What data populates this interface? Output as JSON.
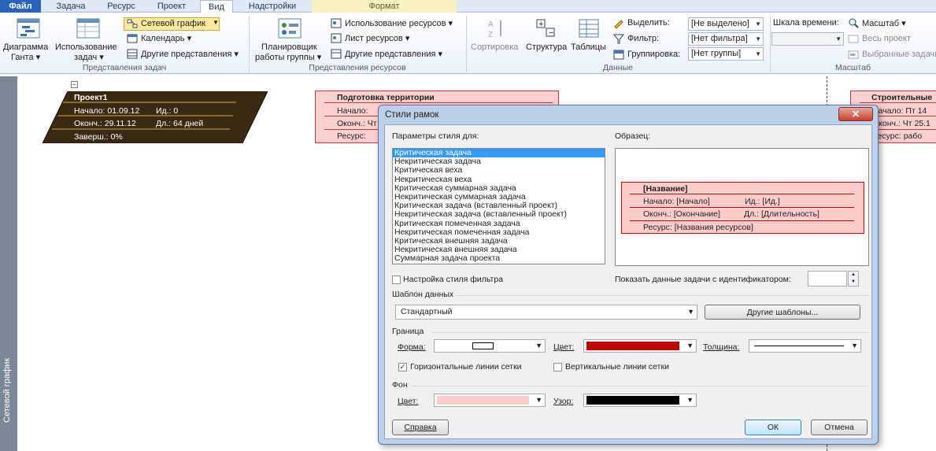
{
  "ribbon": {
    "tabs": [
      {
        "label": "Файл"
      },
      {
        "label": "Задача"
      },
      {
        "label": "Ресурс"
      },
      {
        "label": "Проект"
      },
      {
        "label": "Вид"
      },
      {
        "label": "Надстройки"
      },
      {
        "label": "Формат"
      }
    ],
    "task_views": {
      "gantt": "Диаграмма",
      "gantt2": "Ганта ▾",
      "usage": "Использование",
      "usage2": "задач ▾",
      "network": "Сетевой график",
      "calendar": "Календарь ▾",
      "other": "Другие представления ▾",
      "group_label": "Представления задач"
    },
    "resource_views": {
      "planner": "Планировщик",
      "planner2": "работы группы ▾",
      "usage": "Использование ресурсов ▾",
      "sheet": "Лист ресурсов ▾",
      "other": "Другие представления ▾",
      "group_label": "Представления ресурсов"
    },
    "data": {
      "sort": "Сортировка",
      "outline": "Структура",
      "tables": "Таблицы",
      "highlight_label": "Выделить:",
      "highlight_value": "[Не выделено]",
      "filter_label": "Фильтр:",
      "filter_value": "[Нет фильтра]",
      "group_label": "Группировка:",
      "group_value": "[Нет группы]",
      "section": "Данные"
    },
    "zoom": {
      "timescale": "Шкала времени:",
      "zoom": "Масштаб ▾",
      "entire": "Весь проект",
      "selected": "Выбранные задачи",
      "section": "Масштаб"
    }
  },
  "sidebar": {
    "label": "Сетевой график"
  },
  "nodes": {
    "project": {
      "name": "Проект1",
      "start": "Начало:  01.09.12",
      "id": "Ид.:   0",
      "finish": "Оконч.: 29.11.12",
      "duration": "Дл.: 64 дней",
      "complete": "Заверш.: 0%"
    },
    "site": {
      "name": "Подготовка территории",
      "start": "Начало:",
      "finish": "Оконч.: Чт",
      "resource": "Ресурс:"
    },
    "build": {
      "name": "Строительные",
      "start": "Начало:  Пт 14",
      "finish": "Оконч.: Чт 25.1",
      "resource": "Ресурс:   рабо"
    }
  },
  "dialog": {
    "title": "Стили рамок",
    "close": "✕",
    "params_label": "Параметры стиля для:",
    "sample_label": "Образец:",
    "styles": [
      "Критическая задача",
      "Некритическая задача",
      "Критическая веха",
      "Некритическая веха",
      "Критическая суммарная задача",
      "Некритическая суммарная задача",
      "Критическая задача (вставленный проект)",
      "Некритическая задача (вставленный проект)",
      "Критическая помеченная задача",
      "Некритическая помеченная задача",
      "Критическая внешняя задача",
      "Некритическая внешняя задача",
      "Суммарная задача проекта"
    ],
    "sample": {
      "name": "[Название]",
      "start": "Начало:  [Начало]",
      "id": "Ид.:    [Ид.]",
      "finish": "Оконч.: [Окончание]",
      "duration": "Дл.: [Длительность]",
      "resource": "Ресурс:    [Названия ресурсов]"
    },
    "filter_style": "Настройка стиля фильтра",
    "show_id": "Показать данные задачи с идентификатором:",
    "template_section": "Шаблон данных",
    "template_value": "Стандартный",
    "more_templates": "Другие шаблоны...",
    "border_section": "Граница",
    "shape_label": "Форма:",
    "color_label": "Цвет:",
    "width_label": "Толщина:",
    "hgrid": "Горизонтальные линии сетки",
    "vgrid": "Вертикальные линии сетки",
    "bg_section": "Фон",
    "bg_color_label": "Цвет:",
    "pattern_label": "Узор:",
    "help": "Справка",
    "ok": "ОК",
    "cancel": "Отмена",
    "border_color": "#c00000",
    "bg_color": "#ffcccc",
    "pattern_color": "#000000"
  }
}
